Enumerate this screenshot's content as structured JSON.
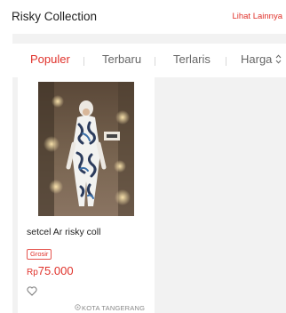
{
  "header": {
    "title": "Risky Collection",
    "see_more": "Lihat Lainnya"
  },
  "tabs": [
    {
      "label": "Populer",
      "active": true
    },
    {
      "label": "Terbaru",
      "active": false
    },
    {
      "label": "Terlaris",
      "active": false
    },
    {
      "label": "Harga",
      "active": false,
      "icon": "sort-icon"
    }
  ],
  "products": [
    {
      "name": "setcel Ar risky coll",
      "badge": "Grosir",
      "currency": "Rp",
      "price": "75.000",
      "location": "KOTA TANGERANG",
      "favorite_icon": "heart-outline-icon",
      "location_icon": "location-pin-icon"
    }
  ],
  "colors": {
    "accent": "#e0322b",
    "background_gray": "#f2f2f2"
  }
}
